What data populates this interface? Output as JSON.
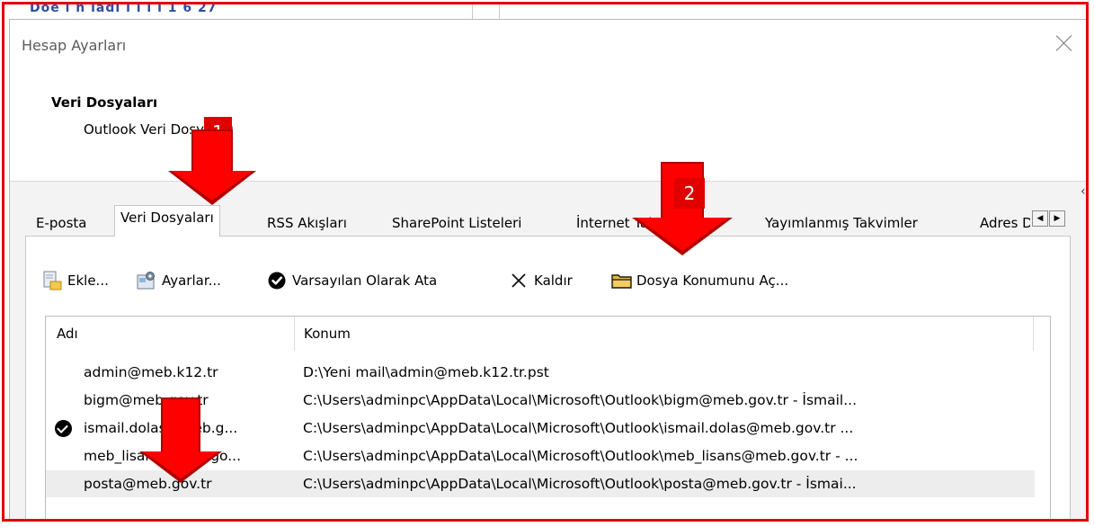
{
  "background": {
    "partial_text": "Doe  i   n    ladi  i  i  i   i          1 6 27"
  },
  "dialog": {
    "title": "Hesap Ayarları",
    "header_title": "Veri Dosyaları",
    "header_subtitle": "Outlook Veri Dosyaları"
  },
  "tabs": [
    {
      "label": "E-posta"
    },
    {
      "label": "Veri Dosyaları",
      "active": true
    },
    {
      "label": "RSS Akışları"
    },
    {
      "label": "SharePoint Listeleri"
    },
    {
      "label": "İnternet Takvimleri"
    },
    {
      "label": "Yayımlanmış Takvimler"
    },
    {
      "label": "Adres Defterleri"
    }
  ],
  "toolbar": {
    "add_label": "Ekle...",
    "settings_label": "Ayarlar...",
    "set_default_label": "Varsayılan Olarak Ata",
    "remove_label": "Kaldır",
    "open_location_label": "Dosya Konumunu Aç..."
  },
  "table": {
    "columns": [
      "Adı",
      "Konum"
    ],
    "rows": [
      {
        "name": "admin@meb.k12.tr",
        "location": "D:\\Yeni mail\\admin@meb.k12.tr.pst",
        "default": false,
        "selected": false
      },
      {
        "name": "bigm@meb.gov.tr",
        "location": "C:\\Users\\adminpc\\AppData\\Local\\Microsoft\\Outlook\\bigm@meb.gov.tr - İsmail...",
        "default": false,
        "selected": false
      },
      {
        "name": "ismail.dolas@meb.g...",
        "location": "C:\\Users\\adminpc\\AppData\\Local\\Microsoft\\Outlook\\ismail.dolas@meb.gov.tr ...",
        "default": true,
        "selected": false
      },
      {
        "name": "meb_lisans@meb.go...",
        "location": "C:\\Users\\adminpc\\AppData\\Local\\Microsoft\\Outlook\\meb_lisans@meb.gov.tr - ...",
        "default": false,
        "selected": false
      },
      {
        "name": "posta@meb.gov.tr",
        "location": "C:\\Users\\adminpc\\AppData\\Local\\Microsoft\\Outlook\\posta@meb.gov.tr - İsmai...",
        "default": false,
        "selected": true
      }
    ]
  },
  "annotations": {
    "step1": "1",
    "step2": "2",
    "arrow_color": "#ff0000",
    "frame_color": "#e00000"
  }
}
